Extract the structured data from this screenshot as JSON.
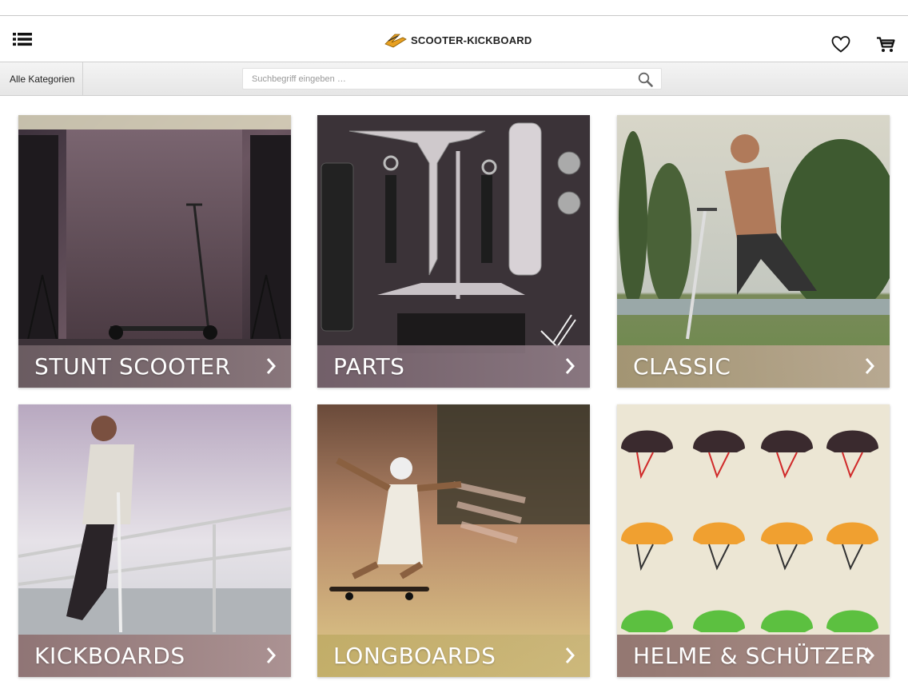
{
  "header": {
    "logo_text": "SCOOTER-KICKBOARD",
    "menu_icon": "list-menu-icon",
    "favorites_icon": "heart-icon",
    "cart_icon": "cart-icon"
  },
  "subbar": {
    "categories_label": "Alle Kategorien",
    "search_placeholder": "Suchbegriff eingeben …",
    "search_icon": "search-icon"
  },
  "tiles": [
    {
      "label": "STUNT SCOOTER"
    },
    {
      "label": "PARTS"
    },
    {
      "label": "CLASSIC"
    },
    {
      "label": "KICKBOARDS"
    },
    {
      "label": "LONGBOARDS"
    },
    {
      "label": "HELME & SCHÜTZER"
    }
  ],
  "colors": {
    "logo_accent": "#e8a020",
    "caption_text": "#ffffff"
  }
}
